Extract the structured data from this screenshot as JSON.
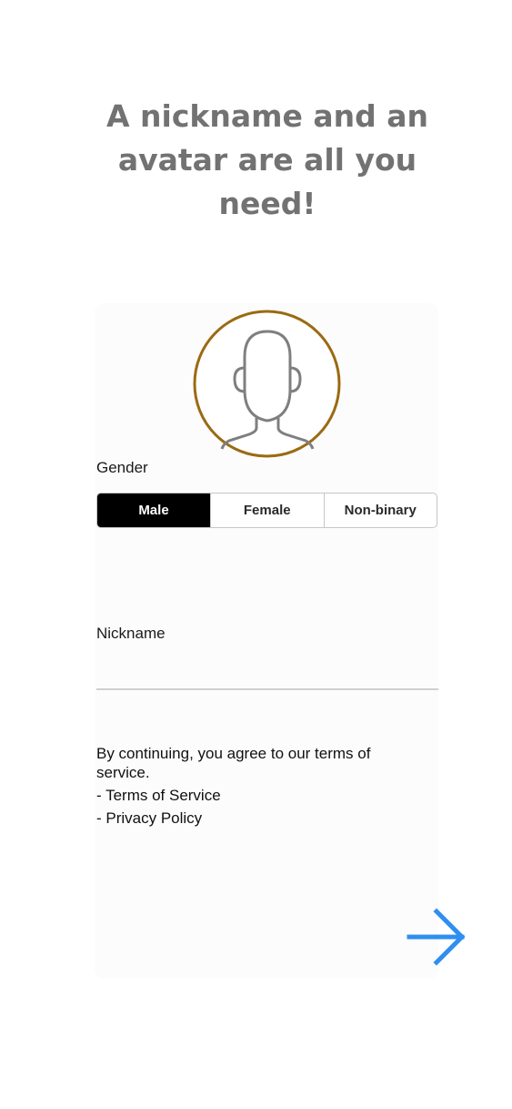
{
  "headline": {
    "line1": "A nickname and an",
    "line2": "avatar are all you",
    "line3": "need!"
  },
  "avatar": {
    "ring_color": "#9a6a12",
    "icon": "person-silhouette-icon"
  },
  "gender": {
    "label": "Gender",
    "options": [
      "Male",
      "Female",
      "Non-binary"
    ],
    "selected": "Male"
  },
  "nickname": {
    "label": "Nickname",
    "value": "",
    "placeholder": ""
  },
  "terms": {
    "intro": "By continuing, you agree to our terms of service.",
    "links": [
      "- Terms of Service",
      "- Privacy Policy"
    ]
  },
  "next": {
    "icon": "arrow-right-icon",
    "color": "#2f8ff0"
  }
}
